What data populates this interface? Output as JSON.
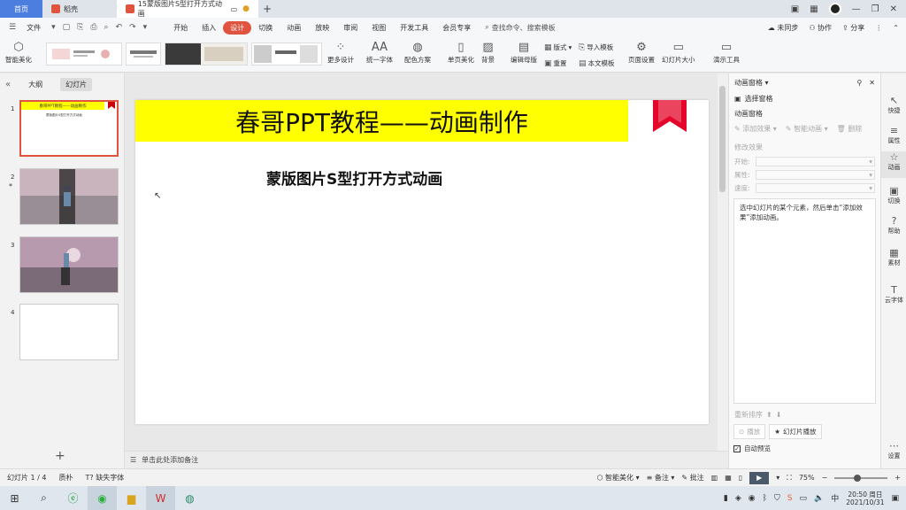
{
  "tabs": {
    "home": "首页",
    "daoke": "稻壳",
    "document": "15蒙版图片S型打开方式动画",
    "add": "+"
  },
  "menu": {
    "file": "文件",
    "items": [
      "开始",
      "插入",
      "设计",
      "切换",
      "动画",
      "放映",
      "审阅",
      "视图",
      "开发工具",
      "会员专享"
    ],
    "active": "设计",
    "search_placeholder": "查找命令、搜索模板",
    "sync": "未同步",
    "collab": "协作",
    "share": "分享"
  },
  "ribbon": {
    "smart_beautify": "智能美化",
    "more_design": "更多设计",
    "unify_font": "统一字体",
    "color_scheme": "配色方案",
    "single_page": "单页美化",
    "background": "背景",
    "edit_master": "编辑母版",
    "layout": "版式",
    "reset": "重置",
    "import_template": "导入模板",
    "text_template": "本文模板",
    "page_setup": "页面设置",
    "slide_size": "幻灯片大小",
    "presenter_tools": "演示工具"
  },
  "left_panel": {
    "outline_tab": "大纲",
    "slides_tab": "幻灯片",
    "slide_numbers": [
      "1",
      "2",
      "3",
      "4"
    ],
    "thumb1_title": "春哥PPT教程——动画制作",
    "thumb1_subtitle": "蒙版图片S型打开方式动画"
  },
  "slide": {
    "title": "春哥PPT教程——动画制作",
    "subtitle": "蒙版图片S型打开方式动画"
  },
  "notes_placeholder": "单击此处添加备注",
  "anim_panel": {
    "header": "动画窗格",
    "select_pane": "选择窗格",
    "section": "动画窗格",
    "add_effect": "添加效果",
    "smart_anim": "智能动画",
    "delete": "删除",
    "modify_effect": "修改效果",
    "start_label": "开始:",
    "property_label": "属性:",
    "speed_label": "速度:",
    "info": "选中幻灯片的某个元素，然后单击“添加效果”添加动画。",
    "reorder": "重新排序",
    "play": "播放",
    "slideshow": "幻灯片播放",
    "auto_preview": "自动预览"
  },
  "right_sidebar": {
    "items": [
      "快捷",
      "属性",
      "动画",
      "切换",
      "帮助",
      "素材",
      "云字体",
      "设置"
    ],
    "active": "动画"
  },
  "status": {
    "slide_count": "幻灯片 1 / 4",
    "theme": "质朴",
    "missing_font": "缺失字体",
    "smart_beautify": "智能美化",
    "notes": "备注",
    "comments": "批注",
    "zoom": "75%"
  },
  "taskbar": {
    "time": "20:50 周日",
    "date": "2021/10/31",
    "ime": "中"
  },
  "colors": {
    "accent": "#e0533f",
    "banner": "#ffff00",
    "tab_home": "#4c7ee0"
  }
}
